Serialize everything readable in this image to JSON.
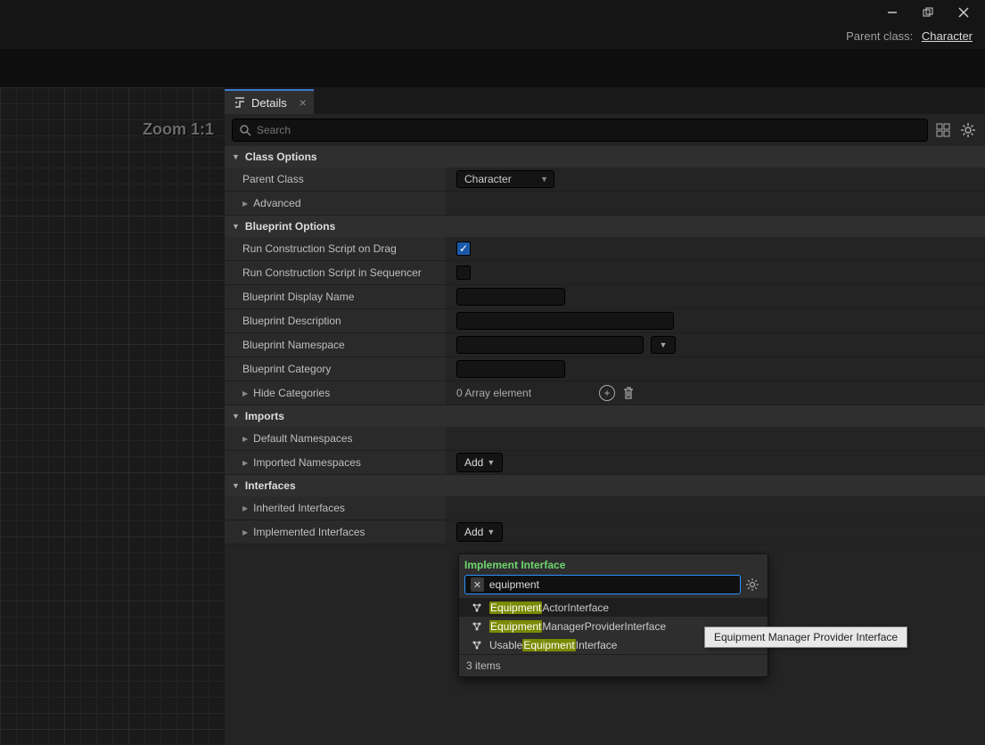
{
  "titlebar": {
    "parent_class_label": "Parent class:",
    "parent_class_value": "Character"
  },
  "zoom": "Zoom 1:1",
  "tab": {
    "label": "Details"
  },
  "search": {
    "placeholder": "Search"
  },
  "sections": {
    "class_options": "Class Options",
    "advanced": "Advanced",
    "blueprint_options": "Blueprint Options",
    "imports": "Imports",
    "interfaces": "Interfaces"
  },
  "rows": {
    "parent_class": {
      "label": "Parent Class",
      "value": "Character"
    },
    "run_cs_drag": {
      "label": "Run Construction Script on Drag",
      "checked": true
    },
    "run_cs_seq": {
      "label": "Run Construction Script in Sequencer",
      "checked": false
    },
    "bp_display": {
      "label": "Blueprint Display Name"
    },
    "bp_desc": {
      "label": "Blueprint Description"
    },
    "bp_ns": {
      "label": "Blueprint Namespace"
    },
    "bp_cat": {
      "label": "Blueprint Category"
    },
    "hide_cat": {
      "label": "Hide Categories",
      "value": "0 Array element"
    },
    "def_ns": {
      "label": "Default Namespaces"
    },
    "imp_ns": {
      "label": "Imported Namespaces",
      "add": "Add"
    },
    "inh_if": {
      "label": "Inherited Interfaces"
    },
    "impl_if": {
      "label": "Implemented Interfaces",
      "add": "Add"
    }
  },
  "popup": {
    "title": "Implement Interface",
    "query": "equipment",
    "items": [
      {
        "pre": "",
        "match": "Equipment",
        "post": "ActorInterface"
      },
      {
        "pre": "",
        "match": "Equipment",
        "post": "ManagerProviderInterface"
      },
      {
        "pre": "Usable",
        "match": "Equipment",
        "post": "Interface"
      }
    ],
    "count": "3 items"
  },
  "tooltip": "Equipment Manager Provider Interface"
}
